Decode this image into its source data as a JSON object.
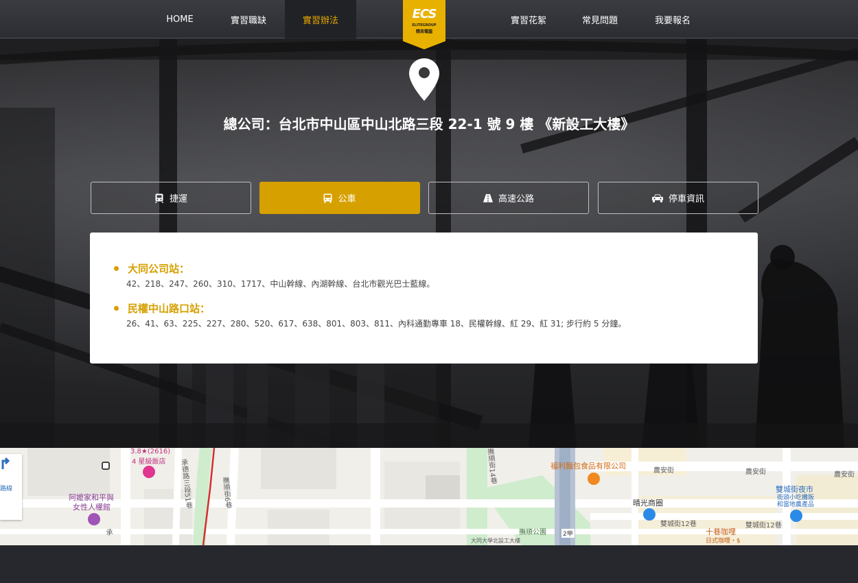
{
  "nav": {
    "items": [
      {
        "label": "HOME",
        "active": false
      },
      {
        "label": "實習職缺",
        "active": false
      },
      {
        "label": "實習辦法",
        "active": true
      },
      {
        "label": "實習花絮",
        "active": false
      },
      {
        "label": "常見問題",
        "active": false
      },
      {
        "label": "我要報名",
        "active": false
      }
    ],
    "logo": {
      "mark": "ECS",
      "sub1": "ELITEGROUP",
      "sub2": "精英電腦"
    }
  },
  "hero": {
    "icon": "map-pin-icon",
    "address": "總公司：台北市中山區中山北路三段 22-1 號 9 樓 《新設工大樓》"
  },
  "tabs": [
    {
      "label": "捷運",
      "icon": "metro-icon",
      "active": false
    },
    {
      "label": "公車",
      "icon": "bus-icon",
      "active": true
    },
    {
      "label": "高速公路",
      "icon": "road-icon",
      "active": false
    },
    {
      "label": "停車資訊",
      "icon": "car-icon",
      "active": false
    }
  ],
  "bus_stops": [
    {
      "name": "大同公司站：",
      "routes": "42、218、247、260、310、1717、中山幹線、內湖幹線、台北市觀光巴士藍線。"
    },
    {
      "name": "民權中山路口站：",
      "routes": "26、41、63、225、227、280、520、617、638、801、803、811、內科通勤專車 18、民權幹線、紅 29、紅 31; 步行約 5 分鐘。"
    }
  ],
  "map": {
    "control_text": "路線",
    "labels": {
      "hotel_rating": "3.8★(2616)",
      "hotel_name": "4 星級飯店",
      "museum1": "阿嬤家和平與",
      "museum2": "女性人權館",
      "road_chengde": "承德路三段51巷",
      "road_fushun": "撫順街6巷",
      "road_14": "撫順街14巷",
      "bakery": "福利麵包食品有限公司",
      "nongan1": "農安街",
      "nongan2": "農安街",
      "nongan3": "農安街",
      "market": "晴光商圈",
      "night_market1": "雙城街夜市",
      "night_market2": "街頭小吃攤販",
      "night_market3": "和當地農產品",
      "shuangcheng1": "雙城街12巷",
      "shuangcheng2": "雙城街12巷",
      "cafe": "十巷咖哩",
      "cafe_sub": "日式咖哩・$",
      "park": "撫順公園",
      "bus_route": "2甲",
      "building": "大同大學北設工大樓",
      "partial_left": "承"
    }
  },
  "colors": {
    "accent": "#d6a000",
    "nav_bg": "#2e3035",
    "card_bg": "#ffffff"
  }
}
